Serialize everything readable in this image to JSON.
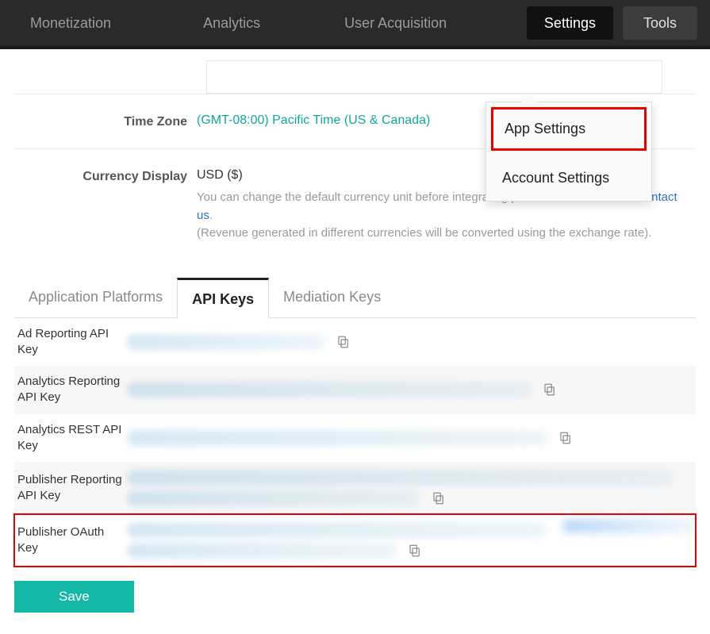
{
  "nav": {
    "monetization": "Monetization",
    "analytics": "Analytics",
    "user_acquisition": "User Acquisition",
    "settings": "Settings",
    "tools": "Tools"
  },
  "dropdown": {
    "app_settings": "App Settings",
    "account_settings": "Account Settings"
  },
  "timezone": {
    "label": "Time Zone",
    "value": "(GMT-08:00) Pacific Time (US & Canada)"
  },
  "currency": {
    "label": "Currency Display",
    "value": "USD ($)",
    "note1": "You can change the default currency unit before integrating purchase event. Please ",
    "contact": "contact us",
    "note1_suffix": ".",
    "note2": "(Revenue generated in different currencies will be converted using the exchange rate)."
  },
  "tabs": {
    "platforms": "Application Platforms",
    "api_keys": "API Keys",
    "mediation": "Mediation Keys"
  },
  "keys": [
    {
      "label": "Ad Reporting API Key"
    },
    {
      "label": "Analytics Reporting API Key"
    },
    {
      "label": "Analytics REST API Key"
    },
    {
      "label": "Publisher Reporting API Key"
    },
    {
      "label": "Publisher OAuth Key"
    }
  ],
  "save": "Save"
}
